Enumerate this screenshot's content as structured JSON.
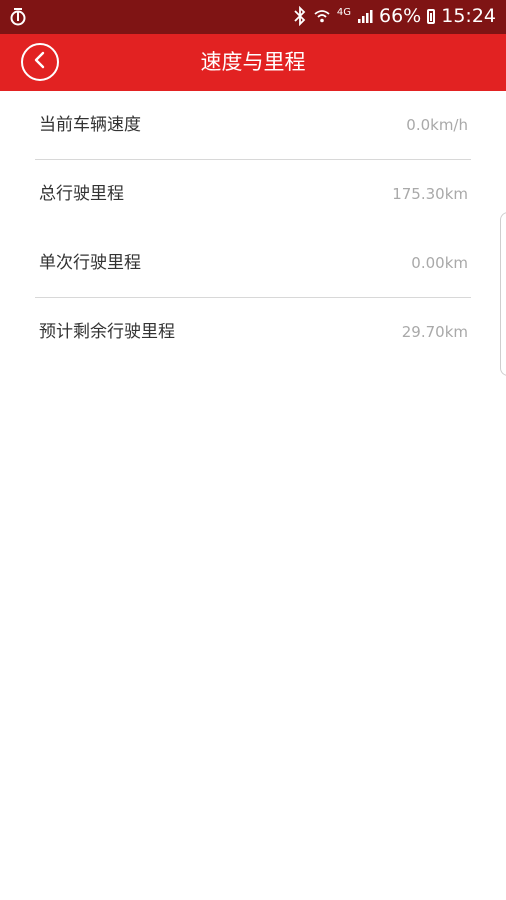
{
  "status_bar": {
    "app_icon": "netease-icon",
    "small_label": "4G",
    "battery": "66%",
    "time": "15:24"
  },
  "header": {
    "title": "速度与里程",
    "back_icon": "chevron-left-icon"
  },
  "rows": [
    {
      "label": "当前车辆速度",
      "value": "0.0km/h"
    },
    {
      "label": "总行驶里程",
      "value": "175.30km"
    },
    {
      "label": "单次行驶里程",
      "value": "0.00km"
    },
    {
      "label": "预计剩余行驶里程",
      "value": "29.70km"
    }
  ],
  "colors": {
    "status_bar": "#7f1414",
    "app_bar": "#e22222",
    "label_text": "#333333",
    "value_text": "#a9a9a9"
  }
}
